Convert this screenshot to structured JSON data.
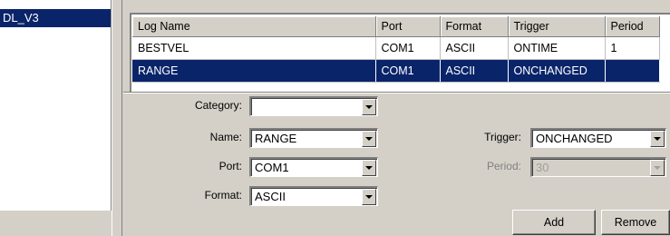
{
  "tree": {
    "selected_item": "DL_V3"
  },
  "log_list": {
    "columns": [
      "Log Name",
      "Port",
      "Format",
      "Trigger",
      "Period"
    ],
    "rows": [
      {
        "log_name": "BESTVEL",
        "port": "COM1",
        "format": "ASCII",
        "trigger": "ONTIME",
        "period": "1",
        "selected": false
      },
      {
        "log_name": "RANGE",
        "port": "COM1",
        "format": "ASCII",
        "trigger": "ONCHANGED",
        "period": "",
        "selected": true
      }
    ]
  },
  "form": {
    "category": {
      "label": "Category:",
      "value": ""
    },
    "name": {
      "label": "Name:",
      "value": "RANGE"
    },
    "port": {
      "label": "Port:",
      "value": "COM1"
    },
    "format": {
      "label": "Format:",
      "value": "ASCII"
    },
    "trigger": {
      "label": "Trigger:",
      "value": "ONCHANGED"
    },
    "period": {
      "label": "Period:",
      "value": "30",
      "disabled": true
    }
  },
  "buttons": {
    "add": "Add",
    "remove": "Remove"
  },
  "colors": {
    "selection": "#0a246a",
    "face": "#d4d0c8"
  }
}
